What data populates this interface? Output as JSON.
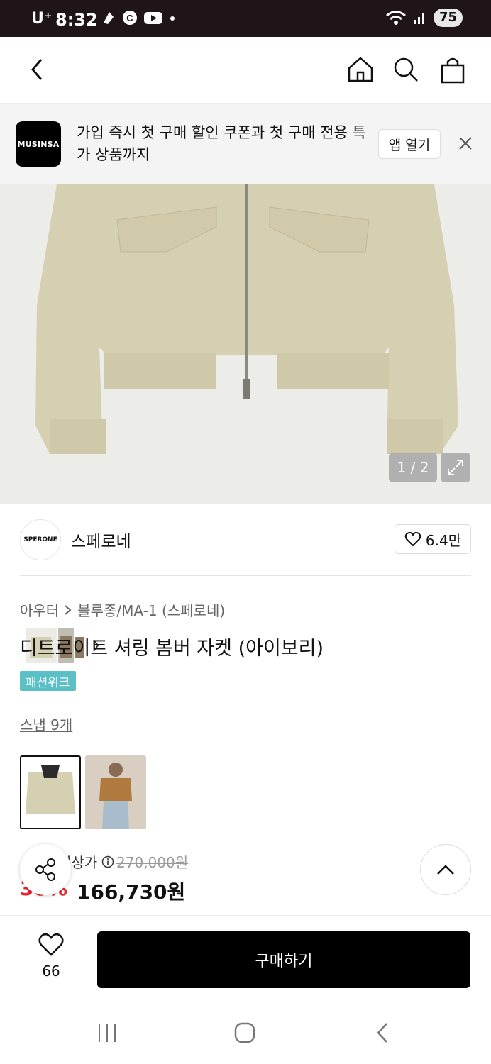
{
  "status_bar": {
    "carrier": "U⁺",
    "time": "8:32",
    "battery": "75"
  },
  "banner": {
    "logo_text": "MUSINSA",
    "message": "가입 즉시 첫 구매 할인 쿠폰과 첫 구매 전용 특가 상품까지",
    "open_app_label": "앱 열기"
  },
  "gallery": {
    "counter": "1 / 2"
  },
  "brand": {
    "logo_text": "SPERONE",
    "name": "스페로네",
    "likes": "6.4만"
  },
  "product": {
    "breadcrumb": [
      "아우터",
      "블루종/MA-1 (스페로네)"
    ],
    "title": "디트로이트 셔링 봄버 자켓 (아이보리)",
    "tag": "패션위크",
    "snap_label": "스냅 9개"
  },
  "price": {
    "label": "정상가",
    "original": "270,000원",
    "discount": "38%",
    "sale": "166,730원"
  },
  "bottom": {
    "wish_count": "66",
    "buy_label": "구매하기"
  },
  "colors": {
    "accent_red": "#e8262b",
    "tag_teal": "#5bc0c6",
    "black": "#000000"
  }
}
